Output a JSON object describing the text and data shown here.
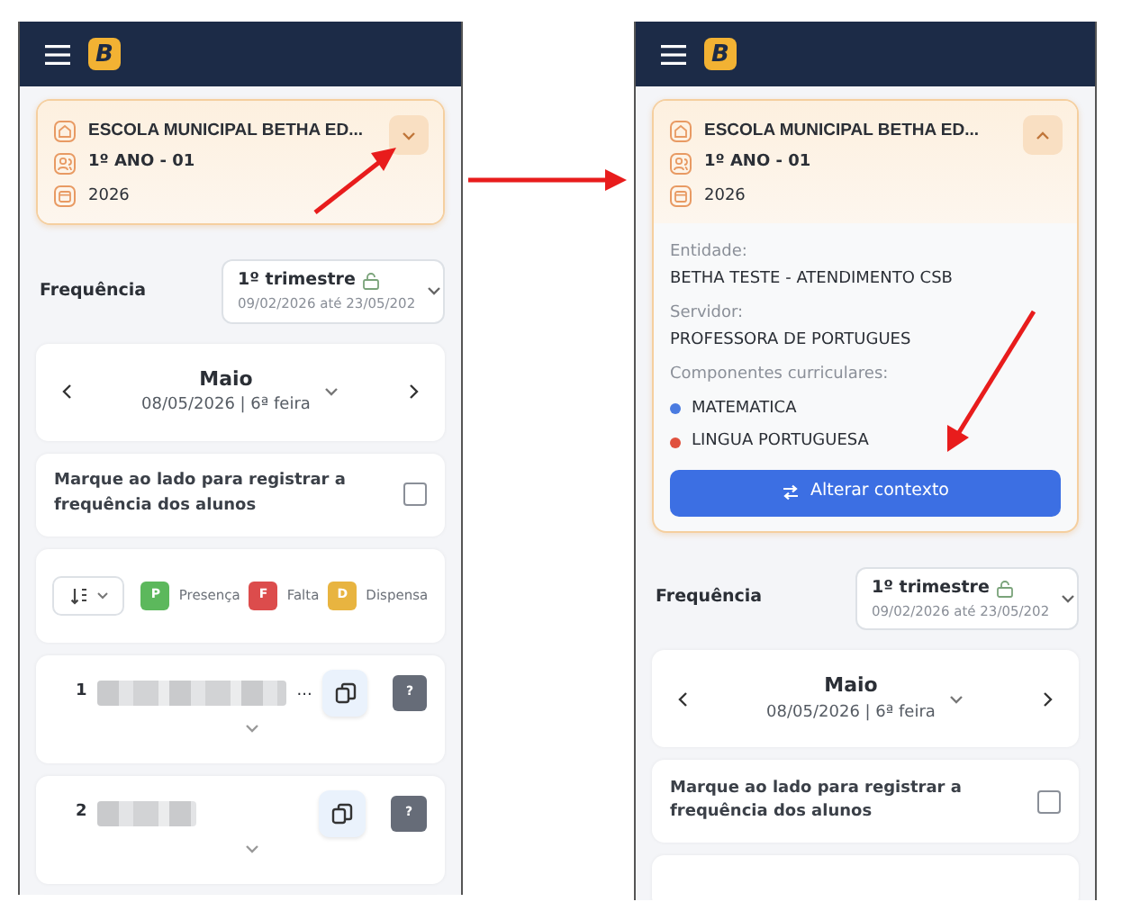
{
  "screens": [
    {
      "logo": "B",
      "context": {
        "school": "ESCOLA MUNICIPAL BETHA ED...",
        "class": "1º ANO - 01",
        "year": "2026",
        "expanded": false
      },
      "frequency": {
        "label": "Frequência",
        "period": "1º trimestre",
        "range": "09/02/2026 até 23/05/202"
      },
      "month": {
        "name": "Maio",
        "date": "08/05/2026 | 6ª feira"
      },
      "register": {
        "text": "Marque ao lado para registrar a frequência dos alunos",
        "checked": false
      },
      "legend": [
        {
          "letter": "P",
          "label": "Presença",
          "color": "#5cb85c"
        },
        {
          "letter": "F",
          "label": "Falta",
          "color": "#dc4c4c"
        },
        {
          "letter": "D",
          "label": "Dispensa",
          "color": "#e8b440"
        }
      ],
      "students": [
        {
          "number": "1",
          "name_tail": "...",
          "help": "?"
        },
        {
          "number": "2",
          "help": "?"
        }
      ]
    },
    {
      "logo": "B",
      "context": {
        "school": "ESCOLA MUNICIPAL BETHA ED...",
        "class": "1º ANO - 01",
        "year": "2026",
        "expanded": true,
        "details": {
          "entity_label": "Entidade:",
          "entity": "BETHA TESTE - ATENDIMENTO CSB",
          "server_label": "Servidor:",
          "server": "PROFESSORA DE PORTUGUES",
          "components_label": "Componentes curriculares:",
          "components": [
            {
              "name": "MATEMATICA",
              "color": "#4a7be0"
            },
            {
              "name": "LINGUA PORTUGUESA",
              "color": "#e0513e"
            }
          ],
          "button": "Alterar contexto"
        }
      },
      "frequency": {
        "label": "Frequência",
        "period": "1º trimestre",
        "range": "09/02/2026 até 23/05/202"
      },
      "month": {
        "name": "Maio",
        "date": "08/05/2026 | 6ª feira"
      },
      "register": {
        "text": "Marque ao lado para registrar a frequência dos alunos",
        "checked": false
      }
    }
  ]
}
